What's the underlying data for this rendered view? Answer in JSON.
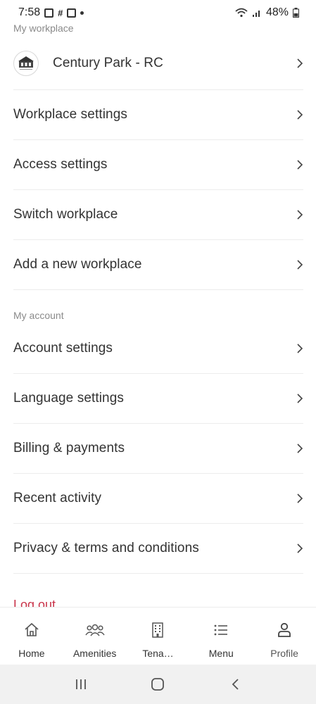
{
  "status_bar": {
    "time": "7:58",
    "battery": "48%"
  },
  "workplace_section": {
    "header": "My workplace",
    "workplace_name": "Century Park - RC",
    "items": [
      {
        "label": "Workplace settings"
      },
      {
        "label": "Access settings"
      },
      {
        "label": "Switch workplace"
      },
      {
        "label": "Add a new workplace"
      }
    ]
  },
  "account_section": {
    "header": "My account",
    "items": [
      {
        "label": "Account settings"
      },
      {
        "label": "Language settings"
      },
      {
        "label": "Billing & payments"
      },
      {
        "label": "Recent activity"
      },
      {
        "label": "Privacy & terms and conditions"
      }
    ]
  },
  "logout_label": "Log out",
  "tabs": [
    {
      "label": "Home",
      "icon": "home-icon"
    },
    {
      "label": "Amenities",
      "icon": "people-icon"
    },
    {
      "label": "Tena…",
      "icon": "building-icon"
    },
    {
      "label": "Menu",
      "icon": "list-icon"
    },
    {
      "label": "Profile",
      "icon": "user-icon",
      "active": true
    }
  ],
  "colors": {
    "logout": "#c9344a",
    "divider": "#ececec",
    "section_header": "#8a8a8a"
  }
}
